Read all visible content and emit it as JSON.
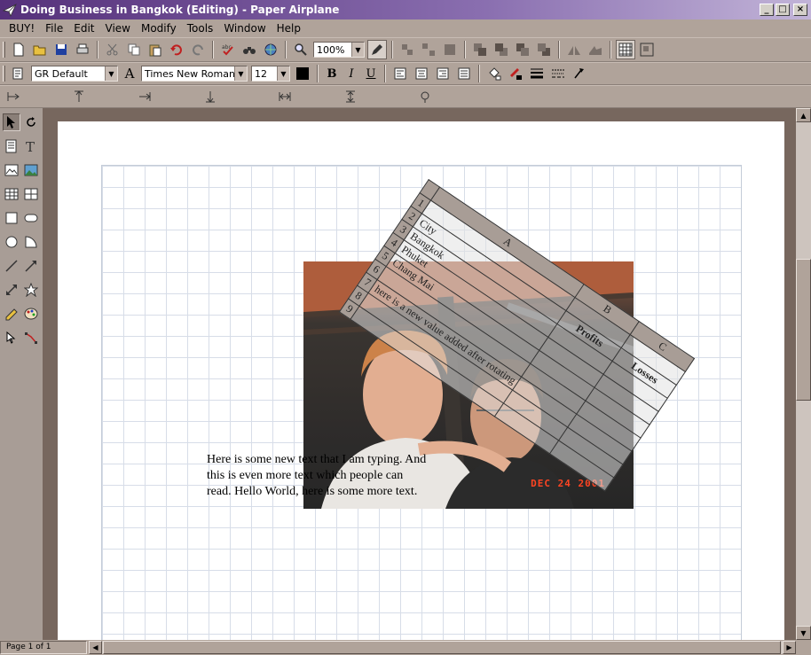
{
  "window": {
    "title": "Doing Business in Bangkok (Editing) - Paper Airplane",
    "minimize": "_",
    "maximize": "□",
    "close": "×"
  },
  "menu": [
    {
      "label": "BUY!"
    },
    {
      "label": "File"
    },
    {
      "label": "Edit"
    },
    {
      "label": "View"
    },
    {
      "label": "Modify"
    },
    {
      "label": "Tools"
    },
    {
      "label": "Window"
    },
    {
      "label": "Help"
    }
  ],
  "toolbar": {
    "zoom": "100%",
    "style": "GR Default",
    "font": "Times New Roman",
    "size": "12",
    "bold": "B",
    "italic": "I",
    "underline": "U"
  },
  "document": {
    "text_lines": [
      "Here is some new text that I am typing.  And",
      "this is even more text which people can",
      "read.  Hello World, here is some more text."
    ],
    "photo_date": "DEC 24 2001",
    "table": {
      "columns": [
        "A",
        "B",
        "C"
      ],
      "rows": [
        {
          "n": "1",
          "a": "",
          "b": "",
          "c": ""
        },
        {
          "n": "2",
          "a": "City",
          "b": "Profits",
          "c": "Losses"
        },
        {
          "n": "3",
          "a": "Bangkok",
          "b": "",
          "c": ""
        },
        {
          "n": "4",
          "a": "Phuket",
          "b": "",
          "c": ""
        },
        {
          "n": "5",
          "a": "Chang Mai",
          "b": "",
          "c": ""
        },
        {
          "n": "6",
          "a": "",
          "b": "",
          "c": ""
        },
        {
          "n": "7",
          "a": "here is a new value added after rotating",
          "b": "",
          "c": ""
        },
        {
          "n": "8",
          "a": "",
          "b": "",
          "c": ""
        },
        {
          "n": "9",
          "a": "",
          "b": "",
          "c": ""
        }
      ]
    }
  },
  "status": {
    "page": "Page 1 of 1"
  }
}
